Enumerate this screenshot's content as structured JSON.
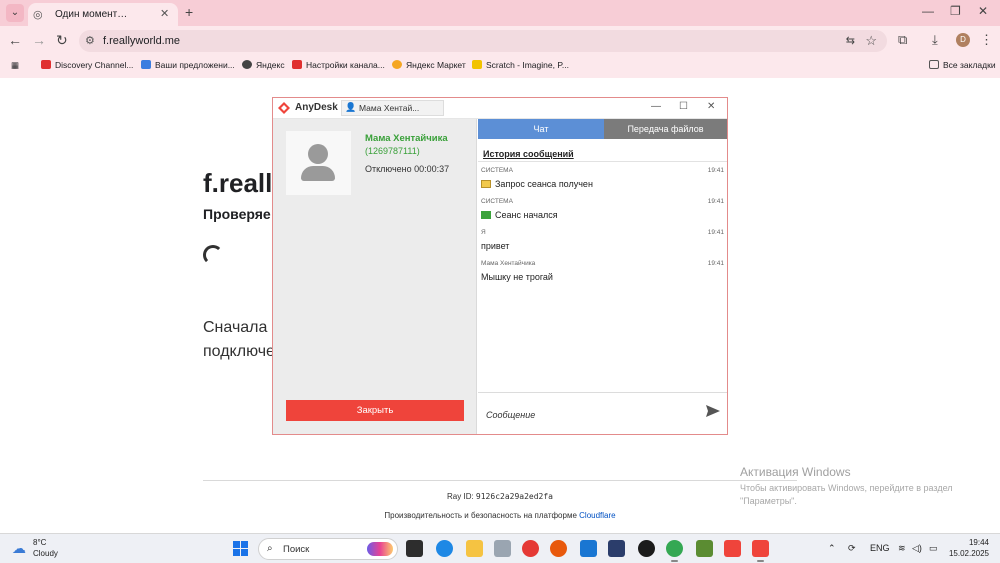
{
  "browser": {
    "tab_title": "Один момент…",
    "url": "f.reallyworld.me",
    "profile_initial": "D",
    "bookmarks": [
      {
        "label": "Discovery Channel...",
        "color": "#e02f2f"
      },
      {
        "label": "Ваши предложени...",
        "color": "#3b7de0"
      },
      {
        "label": "Яндекс",
        "color": "#444444"
      },
      {
        "label": "Настройки канала...",
        "color": "#e02f2f"
      },
      {
        "label": "Яндекс Маркет",
        "color": "#f5a623"
      },
      {
        "label": "Scratch - Imagine, P...",
        "color": "#f2c300"
      }
    ],
    "all_bookmarks": "Все закладки"
  },
  "page": {
    "heading": "f.really",
    "subheading": "Проверяе",
    "text_line1": "Сначала f",
    "text_line2": "подключе",
    "ray_label": "Ray ID:",
    "ray_id": "9126c2a29a2ed2fa",
    "perf_text": "Производительность и безопасность на платформе",
    "perf_link": "Cloudflare"
  },
  "activation": {
    "title": "Активация Windows",
    "line1": "Чтобы активировать Windows, перейдите в раздел",
    "line2": "\"Параметры\"."
  },
  "anydesk": {
    "app_name": "AnyDesk",
    "tab_title": "Мама Хентай...",
    "contact_name": "Мама Хентайчика",
    "contact_id": "(1269787111)",
    "status": "Отключено 00:00:37",
    "close_button": "Закрыть",
    "tab_chat": "Чат",
    "tab_files": "Передача файлов",
    "history_title": "История сообщений",
    "messages": [
      {
        "from": "СИСТЕМА",
        "time": "19:41",
        "text": "Запрос сеанса получен",
        "icon": "request-icon"
      },
      {
        "from": "СИСТЕМА",
        "time": "19:41",
        "text": "Сеанс начался",
        "icon": "session-icon"
      },
      {
        "from": "Я",
        "time": "19:41",
        "text": "привет",
        "icon": ""
      },
      {
        "from": "Мама Хентайчика",
        "time": "19:41",
        "text": "Мышку не трогай",
        "icon": ""
      }
    ],
    "input_placeholder": "Сообщение"
  },
  "taskbar": {
    "weather_temp": "8°C",
    "weather_cond": "Cloudy",
    "search_label": "Поиск",
    "lang": "ENG",
    "time": "19:44",
    "date": "15.02.2025"
  }
}
